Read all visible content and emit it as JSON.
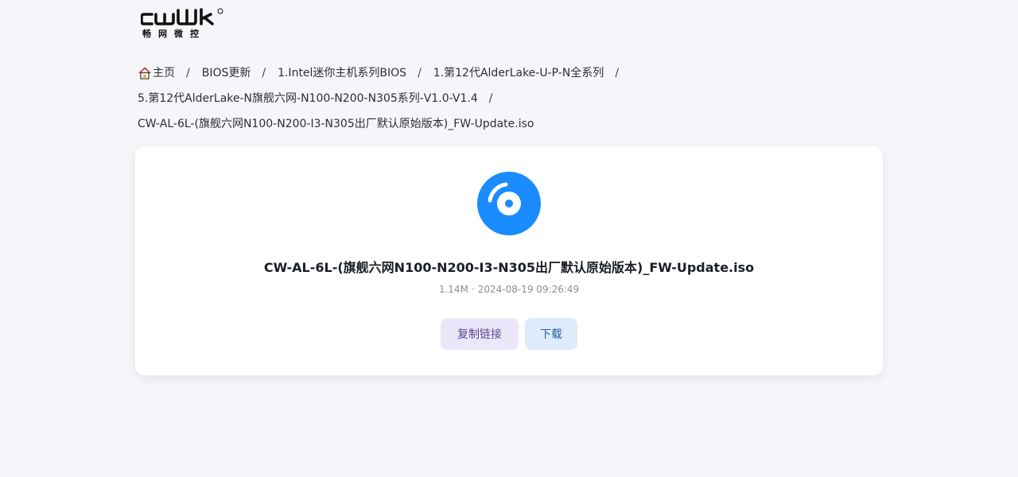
{
  "brand": {
    "logo_text": "CWWK",
    "logo_sub": "畅网微控",
    "registered": "®"
  },
  "breadcrumb": {
    "home_label": "主页",
    "items": [
      "BIOS更新",
      "1.Intel迷你主机系列BIOS",
      "1.第12代AlderLake-U-P-N全系列",
      "5.第12代AlderLake-N旗舰六网-N100-N200-N305系列-V1.0-V1.4",
      "CW-AL-6L-(旗舰六网N100-N200-I3-N305出厂默认原始版本)_FW-Update.iso"
    ],
    "separator": "/"
  },
  "file": {
    "icon": "disc-icon",
    "name": "CW-AL-6L-(旗舰六网N100-N200-I3-N305出厂默认原始版本)_FW-Update.iso",
    "size": "1.14M",
    "meta_sep": "·",
    "date": "2024-08-19 09:26:49"
  },
  "actions": {
    "copy_label": "复制链接",
    "download_label": "下载"
  },
  "colors": {
    "accent": "#1a8cff",
    "copy_bg": "#ece6fa",
    "download_bg": "#ddebfb"
  }
}
